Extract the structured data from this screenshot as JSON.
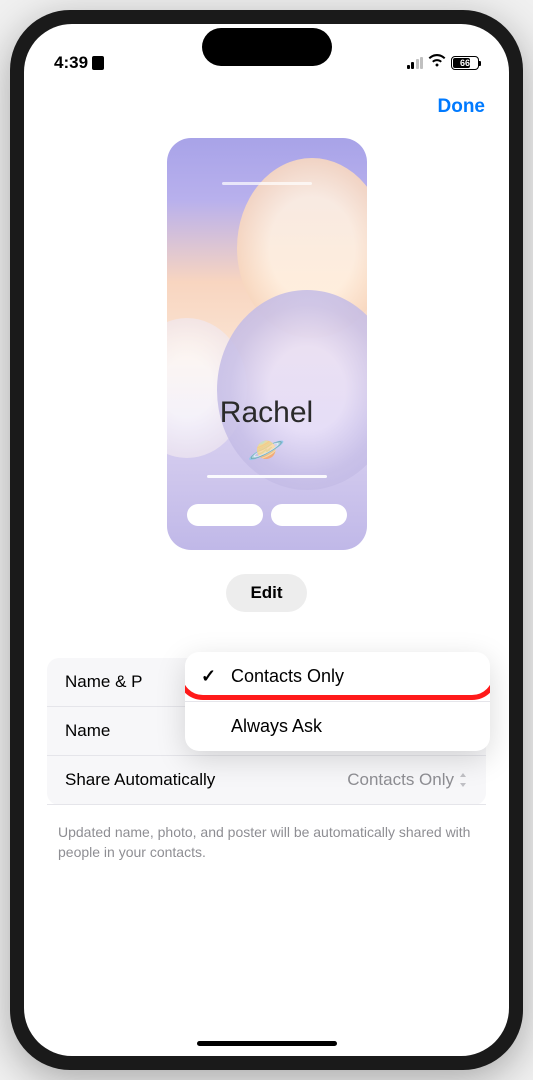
{
  "status": {
    "time": "4:39",
    "battery": "66"
  },
  "nav": {
    "done": "Done"
  },
  "poster": {
    "name": "Rachel",
    "emoji": "🪐"
  },
  "buttons": {
    "edit": "Edit"
  },
  "settings": {
    "row1_label": "Name & P",
    "row2_label": "Name",
    "row3_label": "Share Automatically",
    "row3_value": "Contacts Only"
  },
  "menu": {
    "option1": "Contacts Only",
    "option2": "Always Ask"
  },
  "footer": "Updated name, photo, and poster will be automatically shared with people in your contacts."
}
